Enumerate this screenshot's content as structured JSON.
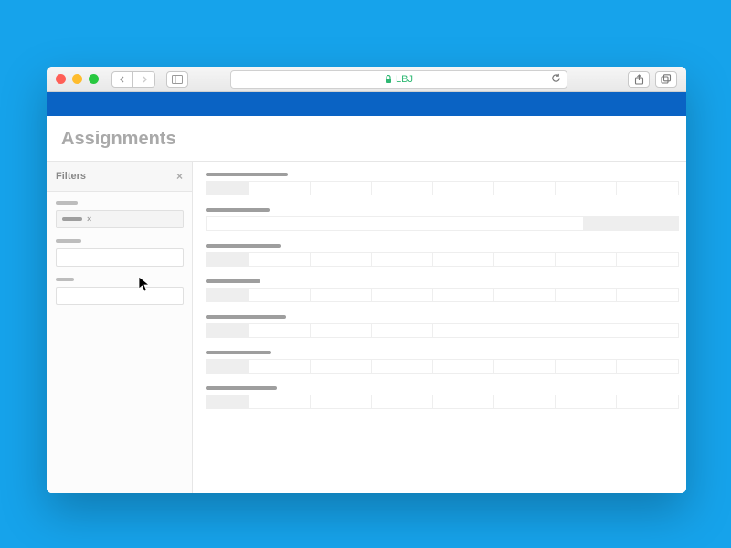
{
  "browser": {
    "url_display": "LBJ"
  },
  "page": {
    "title": "Assignments"
  },
  "filters": {
    "panel_title": "Filters",
    "close_label": "×",
    "tag_close": "×"
  },
  "rows": [
    {
      "label_w": "rl-a",
      "segments": [
        9,
        13,
        13,
        13,
        13,
        13,
        13,
        13
      ]
    },
    {
      "label_w": "rl-b",
      "segments": [
        80,
        10,
        10
      ]
    },
    {
      "label_w": "rl-c",
      "segments": [
        9,
        13,
        13,
        13,
        13,
        13,
        13,
        13
      ]
    },
    {
      "label_w": "rl-d",
      "segments": [
        9,
        13,
        13,
        13,
        13,
        13,
        13,
        13
      ]
    },
    {
      "label_w": "rl-e",
      "segments": [
        9,
        13,
        13,
        13,
        65
      ]
    },
    {
      "label_w": "rl-f",
      "segments": [
        9,
        13,
        13,
        13,
        13,
        13,
        13,
        13
      ]
    },
    {
      "label_w": "rl-g",
      "segments": [
        9,
        13,
        13,
        13,
        13,
        13,
        13,
        13
      ]
    }
  ]
}
